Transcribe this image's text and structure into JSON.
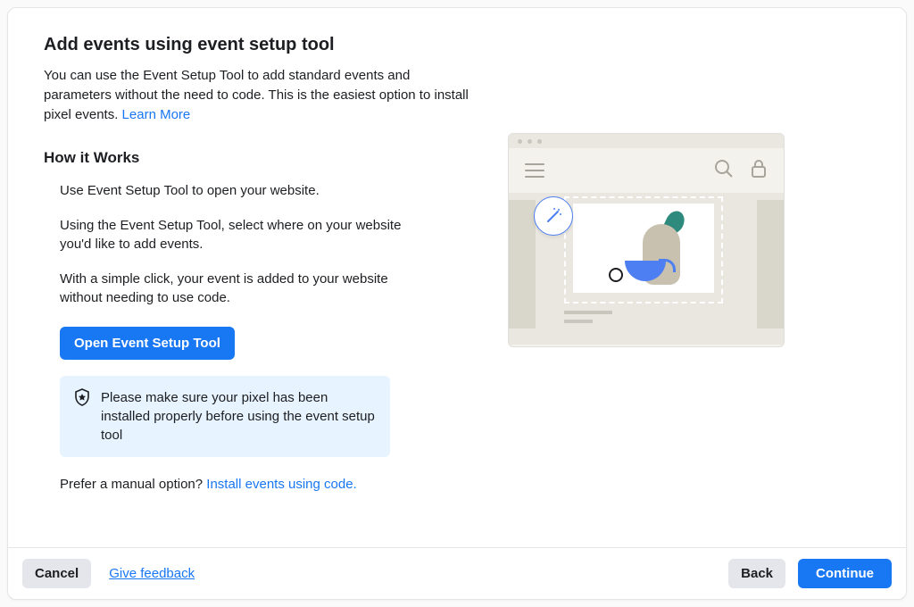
{
  "header": {
    "title": "Add events using event setup tool",
    "description_part1": "You can use the Event Setup Tool to add standard events and parameters without the need to code. This is the easiest option to install pixel events. ",
    "learn_more": "Learn More"
  },
  "how": {
    "title": "How it Works",
    "steps": [
      "Use Event Setup Tool to open your website.",
      "Using the Event Setup Tool, select where on your website you'd like to add events.",
      "With a simple click, your event is added to your website without needing to use code."
    ]
  },
  "actions": {
    "open_tool": "Open Event Setup Tool"
  },
  "notice": {
    "text": "Please make sure your pixel has been installed properly before using the event setup tool"
  },
  "manual": {
    "prefix": "Prefer a manual option? ",
    "link": "Install events using code."
  },
  "footer": {
    "cancel": "Cancel",
    "feedback": "Give feedback",
    "back": "Back",
    "continue": "Continue"
  }
}
